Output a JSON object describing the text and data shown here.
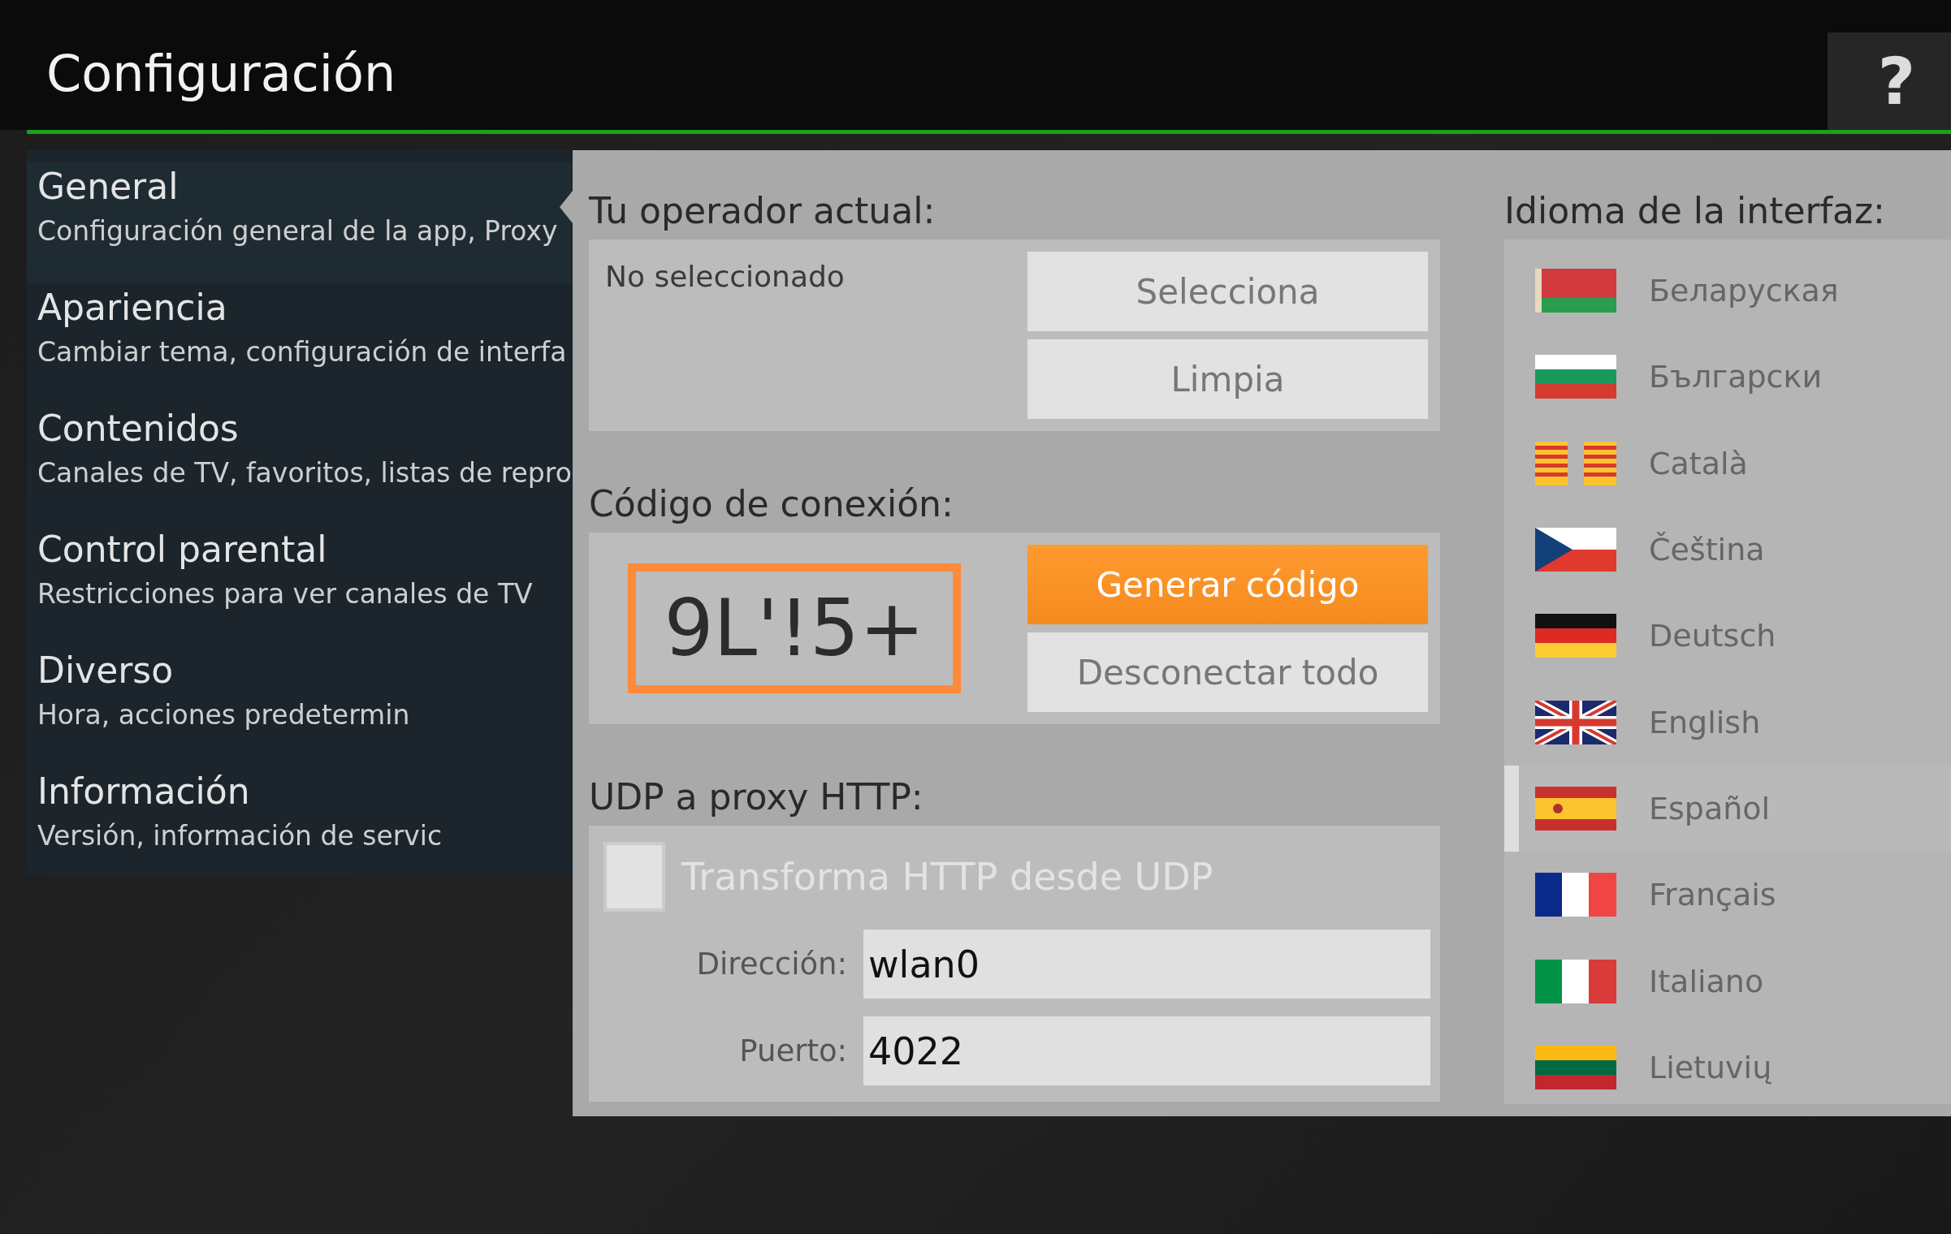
{
  "header": {
    "title": "Configuración",
    "help": "?"
  },
  "sidebar": {
    "items": [
      {
        "title": "General",
        "subtitle": "Configuración general de la app, Proxy",
        "selected": true
      },
      {
        "title": "Apariencia",
        "subtitle": "Cambiar tema, configuración de interfa",
        "selected": false
      },
      {
        "title": "Contenidos",
        "subtitle": "Canales de TV, favoritos, listas de repro",
        "selected": false
      },
      {
        "title": "Control parental",
        "subtitle": "Restricciones para ver canales de TV",
        "selected": false
      },
      {
        "title": "Diverso",
        "subtitle": "Hora, acciones predetermin",
        "selected": false
      },
      {
        "title": "Información",
        "subtitle": "Versión, información de servic",
        "selected": false
      }
    ]
  },
  "operator": {
    "heading": "Tu operador actual:",
    "value": "No seleccionado",
    "buttons": [
      "Selecciona",
      "Limpia"
    ]
  },
  "connection": {
    "heading": "Código de conexión:",
    "code": "9L'!5+",
    "buttons": [
      {
        "label": "Generar código",
        "kind": "primary"
      },
      {
        "label": "Desconectar todo",
        "kind": "normal"
      }
    ]
  },
  "proxy": {
    "heading": "UDP a proxy HTTP:",
    "checkbox": {
      "label": "Transforma HTTP desde UDP",
      "checked": false,
      "disabled": true
    },
    "fields": [
      {
        "label": "Dirección:",
        "value": "wlan0"
      },
      {
        "label": "Puerto:",
        "value": "4022"
      }
    ]
  },
  "language": {
    "heading": "Idioma de la interfaz:",
    "items": [
      {
        "label": "Беларуская",
        "kind": "by",
        "selected": false
      },
      {
        "label": "Български",
        "kind": "bg",
        "selected": false
      },
      {
        "label": "Català",
        "kind": "ca",
        "selected": false
      },
      {
        "label": "Čeština",
        "kind": "cz",
        "selected": false
      },
      {
        "label": "Deutsch",
        "kind": "de",
        "selected": false
      },
      {
        "label": "English",
        "kind": "gb",
        "selected": false
      },
      {
        "label": "Español",
        "kind": "es",
        "selected": true
      },
      {
        "label": "Français",
        "kind": "fr",
        "selected": false
      },
      {
        "label": "Italiano",
        "kind": "it",
        "selected": false
      },
      {
        "label": "Lietuvių",
        "kind": "lt",
        "selected": false
      }
    ]
  }
}
